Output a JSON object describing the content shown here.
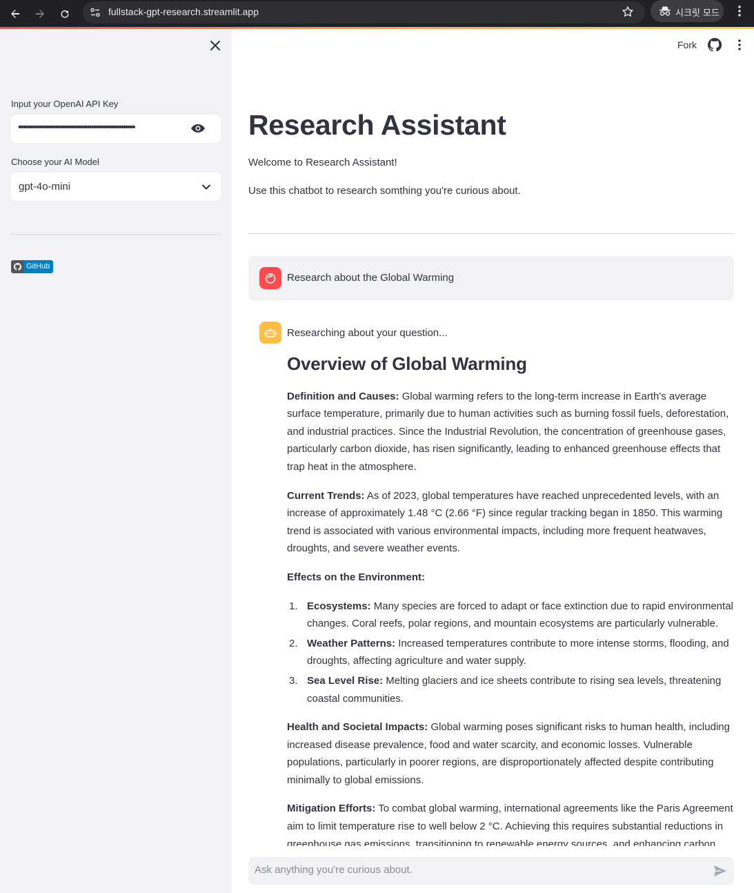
{
  "browser": {
    "url": "fullstack-gpt-research.streamlit.app",
    "incognito_label": "시크릿 모드"
  },
  "sidebar": {
    "api_key_label": "Input your OpenAI API Key",
    "api_key_value": "•••••••••••••••••••••••••••••••••••••••••••••••••••",
    "model_label": "Choose your AI Model",
    "model_value": "gpt-4o-mini",
    "github_badge": "GitHub"
  },
  "header": {
    "fork_label": "Fork"
  },
  "main": {
    "title": "Research Assistant",
    "welcome": "Welcome to Research Assistant!",
    "description": "Use this chatbot to research somthing you're curious about."
  },
  "chat": {
    "user_message": "Research about the Global Warming",
    "assistant_status": "Researching about your question...",
    "heading": "Overview of Global Warming",
    "p1_label": "Definition and Causes:",
    "p1_text": " Global warming refers to the long-term increase in Earth's average surface temperature, primarily due to human activities such as burning fossil fuels, deforestation, and industrial practices. Since the Industrial Revolution, the concentration of greenhouse gases, particularly carbon dioxide, has risen significantly, leading to enhanced greenhouse effects that trap heat in the atmosphere.",
    "p2_label": "Current Trends:",
    "p2_text": " As of 2023, global temperatures have reached unprecedented levels, with an increase of approximately 1.48 °C (2.66 °F) since regular tracking began in 1850. This warming trend is associated with various environmental impacts, including more frequent heatwaves, droughts, and severe weather events.",
    "p3_label": "Effects on the Environment:",
    "list": [
      {
        "num": "1.",
        "label": "Ecosystems:",
        "text": " Many species are forced to adapt or face extinction due to rapid environmental changes. Coral reefs, polar regions, and mountain ecosystems are particularly vulnerable."
      },
      {
        "num": "2.",
        "label": "Weather Patterns:",
        "text": " Increased temperatures contribute to more intense storms, flooding, and droughts, affecting agriculture and water supply."
      },
      {
        "num": "3.",
        "label": "Sea Level Rise:",
        "text": " Melting glaciers and ice sheets contribute to rising sea levels, threatening coastal communities."
      }
    ],
    "p4_label": "Health and Societal Impacts:",
    "p4_text": " Global warming poses significant risks to human health, including increased disease prevalence, food and water scarcity, and economic losses. Vulnerable populations, particularly in poorer regions, are disproportionately affected despite contributing minimally to global emissions.",
    "p5_label": "Mitigation Efforts:",
    "p5_text": " To combat global warming, international agreements like the Paris Agreement aim to limit temperature rise to well below 2 °C. Achieving this requires substantial reductions in greenhouse gas emissions, transitioning to renewable energy sources, and enhancing carbon"
  },
  "input": {
    "placeholder": "Ask anything you're curious about."
  },
  "colors": {
    "accent_red": "#ff4b4b",
    "bot_avatar": "#ffbd45",
    "sidebar_bg": "#f0f2f6",
    "badge_blue": "#007ec6"
  }
}
